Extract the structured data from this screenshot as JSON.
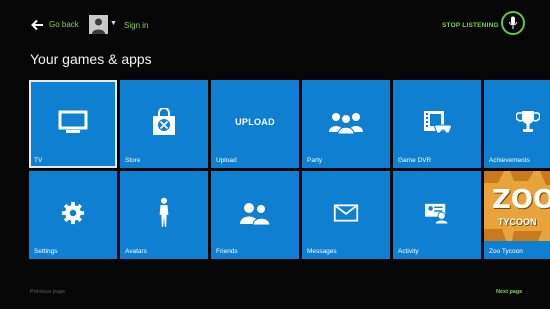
{
  "header": {
    "back_label": "Go back",
    "signin_label": "Sign in",
    "stop_listening_label": "STOP LISTENING"
  },
  "page_title": "Your games & apps",
  "tiles": [
    {
      "label": "TV",
      "icon": "tv-icon",
      "selected": true
    },
    {
      "label": "Store",
      "icon": "store-bag-icon"
    },
    {
      "label": "Upload",
      "icon": "upload-text"
    },
    {
      "label": "Party",
      "icon": "party-people-icon"
    },
    {
      "label": "Game DVR",
      "icon": "film-controller-icon"
    },
    {
      "label": "Achievements",
      "icon": "trophy-icon"
    },
    {
      "label": "Settings",
      "icon": "gear-icon"
    },
    {
      "label": "Avatars",
      "icon": "avatar-figure-icon"
    },
    {
      "label": "Friends",
      "icon": "friends-icon"
    },
    {
      "label": "Messages",
      "icon": "envelope-icon"
    },
    {
      "label": "Activity",
      "icon": "activity-icon"
    },
    {
      "label": "Zoo Tycoon",
      "icon": "zoo-tycoon-art"
    }
  ],
  "upload_text": "UPLOAD",
  "zoo_art": {
    "title": "ZOO",
    "subtitle": "TYCOON"
  },
  "footer": {
    "previous_page": "Previous page",
    "next_page": "Next page"
  },
  "colors": {
    "background": "#060606",
    "tile_blue": "#0f7fd1",
    "accent_green": "#7fd34a"
  }
}
